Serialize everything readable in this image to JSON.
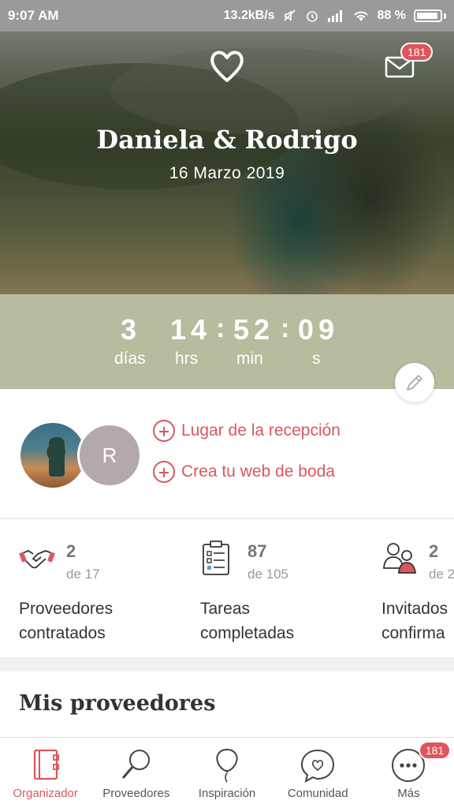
{
  "status_bar": {
    "time": "9:07 AM",
    "network_speed": "13.2kB/s",
    "battery": "88 %"
  },
  "hero": {
    "couple_names": "Daniela & Rodrigo",
    "wedding_date": "16 Marzo 2019",
    "mail_badge": "181"
  },
  "countdown": {
    "days": "3",
    "hours": "14",
    "minutes": "52",
    "seconds": "09",
    "days_label": "días",
    "hours_label": "hrs",
    "minutes_label": "min",
    "seconds_label": "s"
  },
  "profile": {
    "partner_initial": "R",
    "actions": [
      {
        "label": "Lugar de la recepción"
      },
      {
        "label": "Crea tu web de boda"
      }
    ]
  },
  "stats": [
    {
      "count": "2",
      "of": "de 17",
      "label_line1": "Proveedores",
      "label_line2": "contratados",
      "icon": "handshake-icon"
    },
    {
      "count": "87",
      "of": "de 105",
      "label_line1": "Tareas",
      "label_line2": "completadas",
      "icon": "clipboard-checklist-icon"
    },
    {
      "count": "2",
      "of": "de 2",
      "label_line1": "Invitados",
      "label_line2": "confirma",
      "icon": "guests-icon"
    }
  ],
  "section": {
    "title": "Mis proveedores"
  },
  "bottom_nav": {
    "items": [
      {
        "label": "Organizador",
        "icon": "planner-book-icon",
        "active": true
      },
      {
        "label": "Proveedores",
        "icon": "magnifier-icon",
        "active": false
      },
      {
        "label": "Inspiración",
        "icon": "balloon-icon",
        "active": false
      },
      {
        "label": "Comunidad",
        "icon": "chat-heart-icon",
        "active": false
      },
      {
        "label": "Más",
        "icon": "more-dots-icon",
        "active": false
      }
    ],
    "more_badge": "181"
  },
  "colors": {
    "accent": "#d9575e",
    "countdown_bg": "#b8bb9d",
    "status_bar": "#9a9a9a"
  }
}
